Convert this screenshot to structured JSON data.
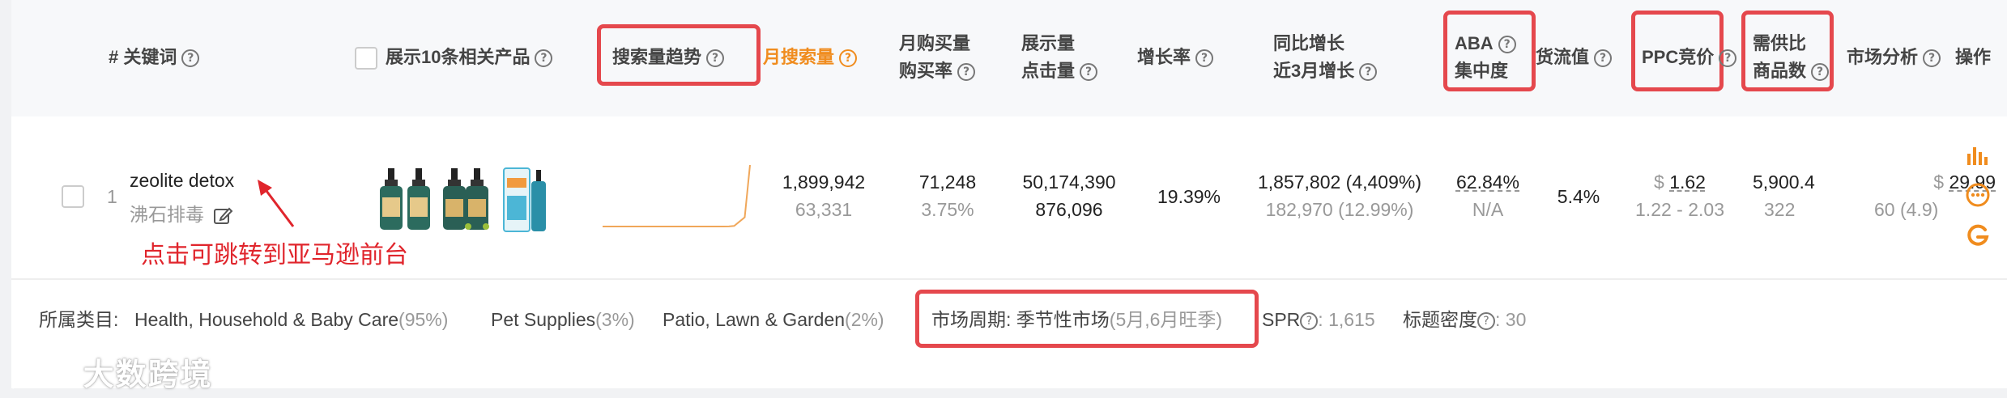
{
  "header": {
    "keyword_col": "# 关键词",
    "show_products": "展示10条相关产品",
    "search_trend": "搜索量趋势",
    "monthly_search": "月搜索量",
    "monthly_buy_1": "月购买量",
    "monthly_buy_2": "购买率",
    "display_1": "展示量",
    "display_2": "点击量",
    "growth": "增长率",
    "yoy_1": "同比增长",
    "yoy_2": "近3月增长",
    "aba_1": "ABA",
    "aba_2": "集中度",
    "goods_value": "货流值",
    "ppc": "PPC竞价",
    "supply_1": "需供比",
    "supply_2": "商品数",
    "market": "市场分析",
    "ops": "操作"
  },
  "row": {
    "index": "1",
    "keyword": "zeolite detox",
    "keyword_cn": "沸石排毒",
    "monthly_search": "1,899,942",
    "monthly_search_sub": "63,331",
    "monthly_buy": "71,248",
    "buy_rate": "3.75%",
    "display": "50,174,390",
    "clicks": "876,096",
    "growth": "19.39%",
    "yoy": "1,857,802 (4,409%)",
    "recent3": "182,970 (12.99%)",
    "aba": "62.84%",
    "aba_sub": "N/A",
    "goods_value": "5.4%",
    "ppc_currency": "$",
    "ppc": "1.62",
    "ppc_range": "1.22 - 2.03",
    "supply": "5,900.4",
    "supply_sub": "322",
    "market_currency": "$",
    "market_price": "29.99",
    "market_sub": "60 (4.9)"
  },
  "annotation": "点击可跳转到亚马逊前台",
  "footer": {
    "category_label": "所属类目:",
    "cat1": "Health, Household & Baby Care",
    "cat1_pct": "(95%)",
    "cat2": "Pet Supplies",
    "cat2_pct": "(3%)",
    "cat3": "Patio, Lawn & Garden",
    "cat3_pct": "(2%)",
    "cycle_label": "市场周期: 季节性市场",
    "cycle_note": "(5月,6月旺季)",
    "spr_label": "SPR",
    "spr_value": ": 1,615",
    "title_density_label": "标题密度",
    "title_density_value": ": 30"
  },
  "watermark": "大数跨境",
  "trend_chart": {
    "type": "line",
    "values": [
      0,
      0,
      0,
      0,
      0,
      0,
      0,
      0,
      0,
      0,
      0,
      0,
      0,
      0,
      0,
      0,
      0,
      0,
      0,
      0,
      0,
      0,
      0,
      0,
      0.2,
      1,
      8,
      15,
      100
    ],
    "color": "#f0a75a"
  },
  "icons": {
    "help": "help-circle-icon",
    "edit": "edit-icon",
    "bar_chart": "bar-chart-icon",
    "more": "more-icon",
    "google": "google-icon"
  },
  "colors": {
    "accent": "#f08c1e",
    "highlight_box": "#e5484d",
    "annotation": "#e0252c"
  }
}
